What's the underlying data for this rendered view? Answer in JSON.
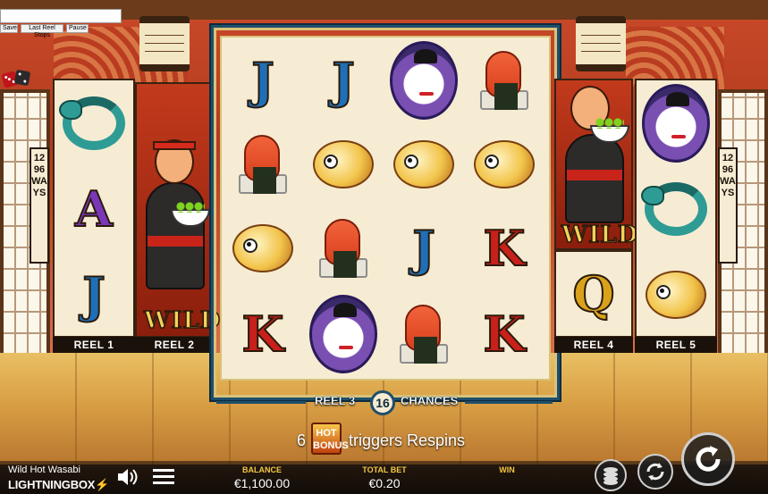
{
  "top_controls": {
    "input_value": "",
    "save_label": "Save",
    "last_reel_stops_label": "Last Reel Stops",
    "pause_label": "Pause"
  },
  "reels": {
    "reel1_label": "REEL 1",
    "reel2_label": "REEL 2",
    "reel4_label": "REEL 4",
    "reel5_label": "REEL 5",
    "reel1_symbols": [
      "eel",
      "A",
      "J"
    ],
    "reel2_symbol": "WILD",
    "reel3_symbols": [
      [
        "J",
        "J",
        "geisha",
        "shrimp"
      ],
      [
        "shrimp",
        "pufferfish",
        "pufferfish",
        "pufferfish"
      ],
      [
        "pufferfish",
        "shrimp",
        "J",
        "K"
      ],
      [
        "K",
        "geisha",
        "shrimp",
        "K"
      ]
    ],
    "reel4_symbols": [
      "WILD",
      "Q"
    ],
    "reel5_symbols": [
      "geisha",
      "eel",
      "pufferfish"
    ],
    "wild_text": "WILD"
  },
  "ways": {
    "left": "1296 WAYS",
    "right": "1296 WAYS"
  },
  "chances": {
    "reel_label": "REEL 3",
    "count": "16",
    "chances_label": "CHANCES"
  },
  "respin": {
    "count": "6",
    "hot_bonus_label": "HOT BONUS",
    "text": "triggers Respins"
  },
  "footer": {
    "game_title": "Wild Hot Wasabi",
    "brand_main": "LIGHTNING",
    "brand_box": "BOX",
    "balance_label": "BALANCE",
    "balance_value": "€1,100.00",
    "bet_label": "TOTAL BET",
    "bet_value": "€0.20",
    "win_label": "WIN",
    "win_value": ""
  },
  "colors": {
    "letter_blue": "#1f6fb8",
    "letter_purple": "#7a38b8",
    "letter_red": "#c8201a",
    "letter_gold": "#d9a21a",
    "frame_teal": "#1e4f6b",
    "label_gold": "#f2c744"
  },
  "icons": [
    "dice-icon",
    "sound-icon",
    "menu-icon",
    "coins-icon",
    "autoplay-icon",
    "spin-icon"
  ]
}
